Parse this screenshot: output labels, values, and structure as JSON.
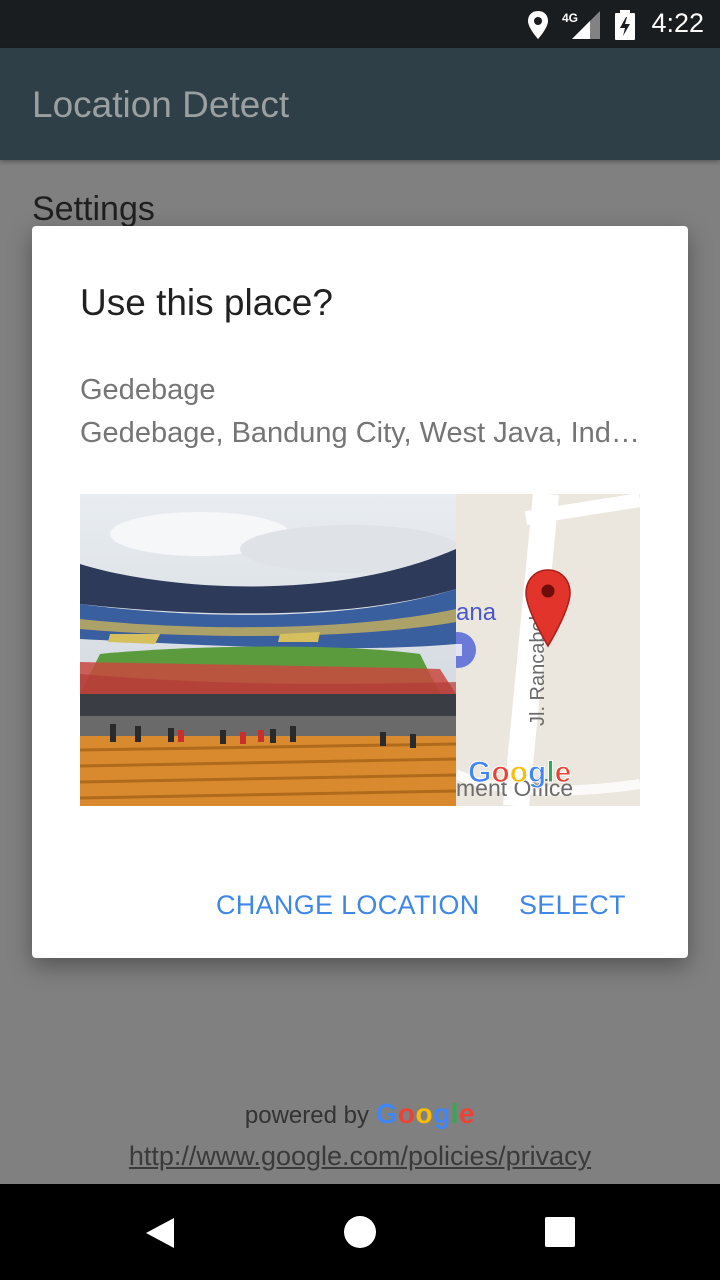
{
  "status_bar": {
    "time": "4:22",
    "network": "4G",
    "icons": [
      "location-icon",
      "signal-4g-icon",
      "battery-charging-icon"
    ]
  },
  "app_bar": {
    "title": "Location Detect"
  },
  "background": {
    "settings_label": "Settings",
    "powered_by_prefix": "powered by",
    "google_brand": "Google",
    "privacy_link": "http://www.google.com/policies/privacy"
  },
  "dialog": {
    "title": "Use this place?",
    "place_name": "Gedebage",
    "place_address": "Gedebage, Bandung City, West Java, Indonesia",
    "map": {
      "street_label": "Jl. Rancabolang",
      "poi_fragment": "ana",
      "poi_fragment2": "ment Office",
      "watermark": "Google",
      "pin_icon": "map-pin-icon"
    },
    "actions": {
      "change_location": "CHANGE LOCATION",
      "select": "SELECT"
    }
  },
  "nav_bar": {
    "icons": [
      "back-icon",
      "home-icon",
      "recents-icon"
    ]
  },
  "colors": {
    "status_bar": "#1a1d1f",
    "app_bar": "#2f3f47",
    "scrim_background": "#808080",
    "dialog": "#ffffff",
    "accent": "#3f87e6",
    "secondary_text": "#757575"
  }
}
